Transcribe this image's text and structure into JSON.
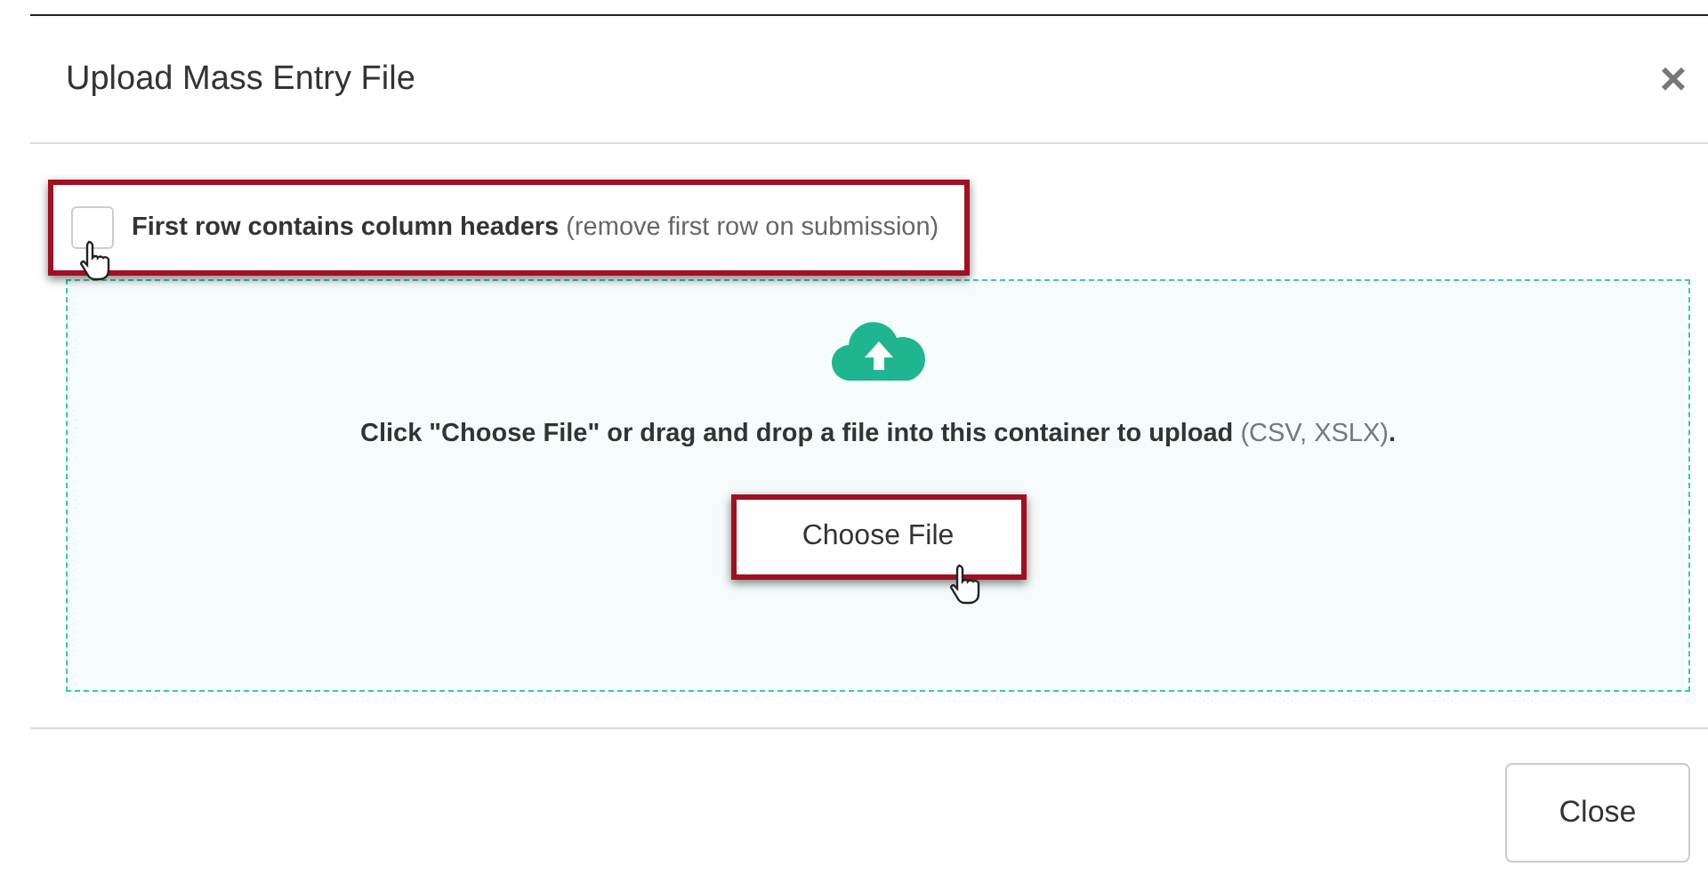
{
  "dialog": {
    "title": "Upload Mass Entry File",
    "close_icon": "×"
  },
  "option": {
    "label": "**First row contains column headers** (remove first row on submission)",
    "checked": false,
    "highlighted": true
  },
  "dropzone": {
    "instructions": "**Click \"Choose File\" or drag and drop a file into this container to upload** (CSV, XSLX)**.**",
    "button": "Choose File",
    "button_highlighted": true
  },
  "footer": {
    "buttons": [
      "Close"
    ]
  }
}
